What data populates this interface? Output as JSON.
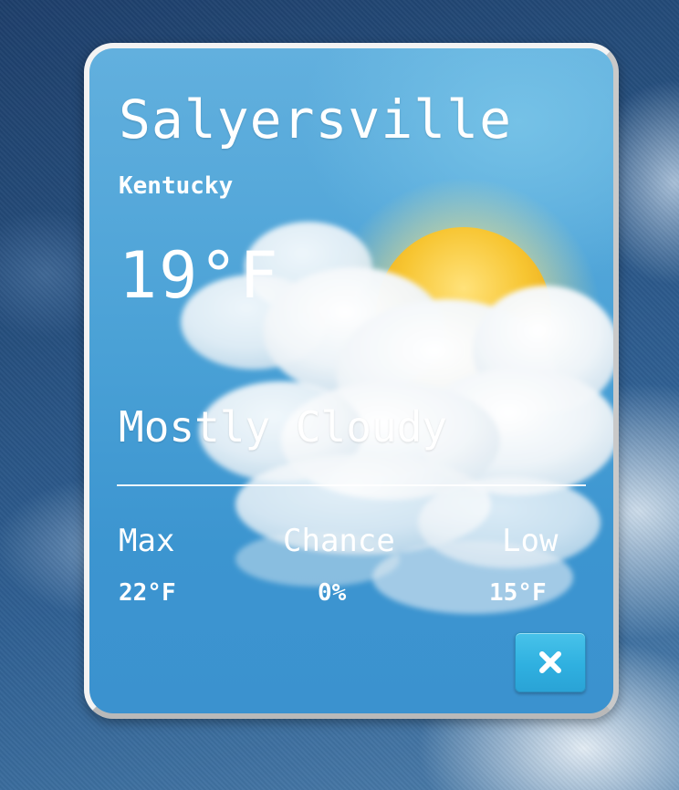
{
  "weather": {
    "city": "Salyersville",
    "state": "Kentucky",
    "temperature": "19°F",
    "condition": "Mostly Cloudy",
    "icon": "sun-behind-cloud-icon"
  },
  "stats": {
    "max": {
      "label": "Max",
      "value": "22°F"
    },
    "chance": {
      "label": "Chance",
      "value": "0%"
    },
    "low": {
      "label": "Low",
      "value": "15°F"
    }
  },
  "close_button": {
    "icon": "close-icon"
  },
  "colors": {
    "card_blue": "#4aa1d6",
    "button_blue": "#2fb0e0",
    "text": "#ffffff",
    "sun": "#f5c02a"
  }
}
